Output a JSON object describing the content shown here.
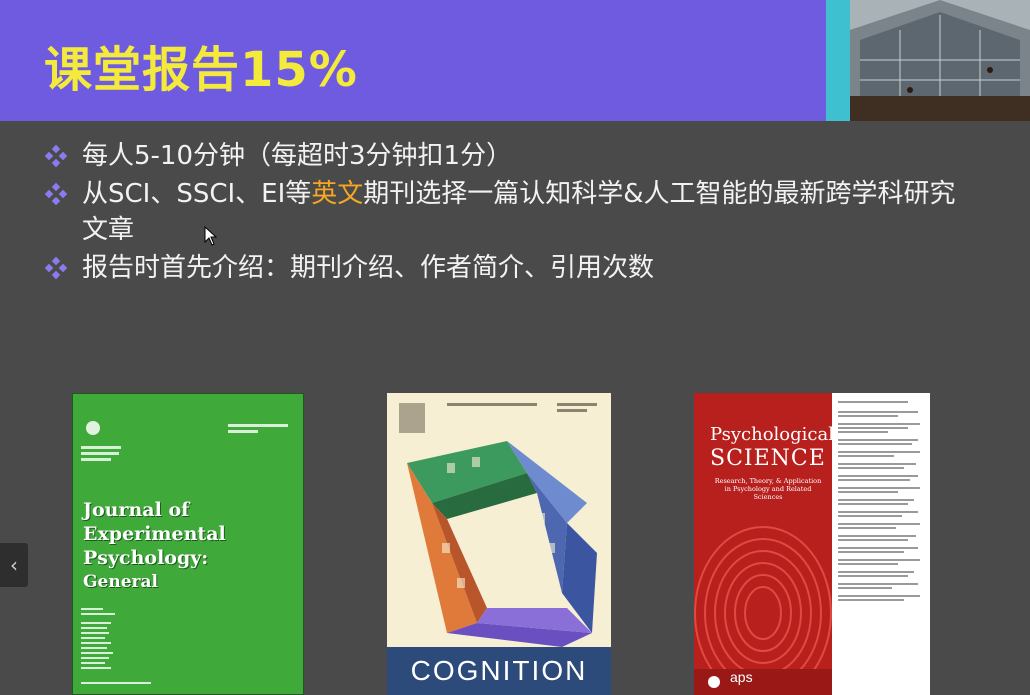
{
  "slide": {
    "title": "课堂报告15%",
    "bullets": [
      {
        "text": "每人5-10分钟（每超时3分钟扣1分）"
      },
      {
        "before": "从SCI、SSCI、EI等",
        "highlight": "英文",
        "after": "期刊选择一篇认知科学&人工智能的最新跨学科研究文章"
      },
      {
        "text": "报告时首先介绍：期刊介绍、作者简介、引用次数"
      }
    ],
    "colors": {
      "header_bg": "#6f5be0",
      "title": "#f4ea3c",
      "highlight": "#f5a623",
      "bullet_marker": "#8a7cf0",
      "body_bg": "#4a4a4a"
    }
  },
  "covers": {
    "jep": {
      "title_line1": "Journal of",
      "title_line2": "Experimental",
      "title_line3": "Psychology:",
      "title_line4": "General"
    },
    "cognition": {
      "title": "COGNITION"
    },
    "psych_science": {
      "title_line1": "Psychological",
      "title_line2": "SCIENCE",
      "subtitle": "Research, Theory, & Application in Psychology and Related Sciences",
      "publisher": "aps"
    }
  },
  "nav": {
    "prev_icon": "chevron-left-icon",
    "prev_glyph": "‹"
  }
}
